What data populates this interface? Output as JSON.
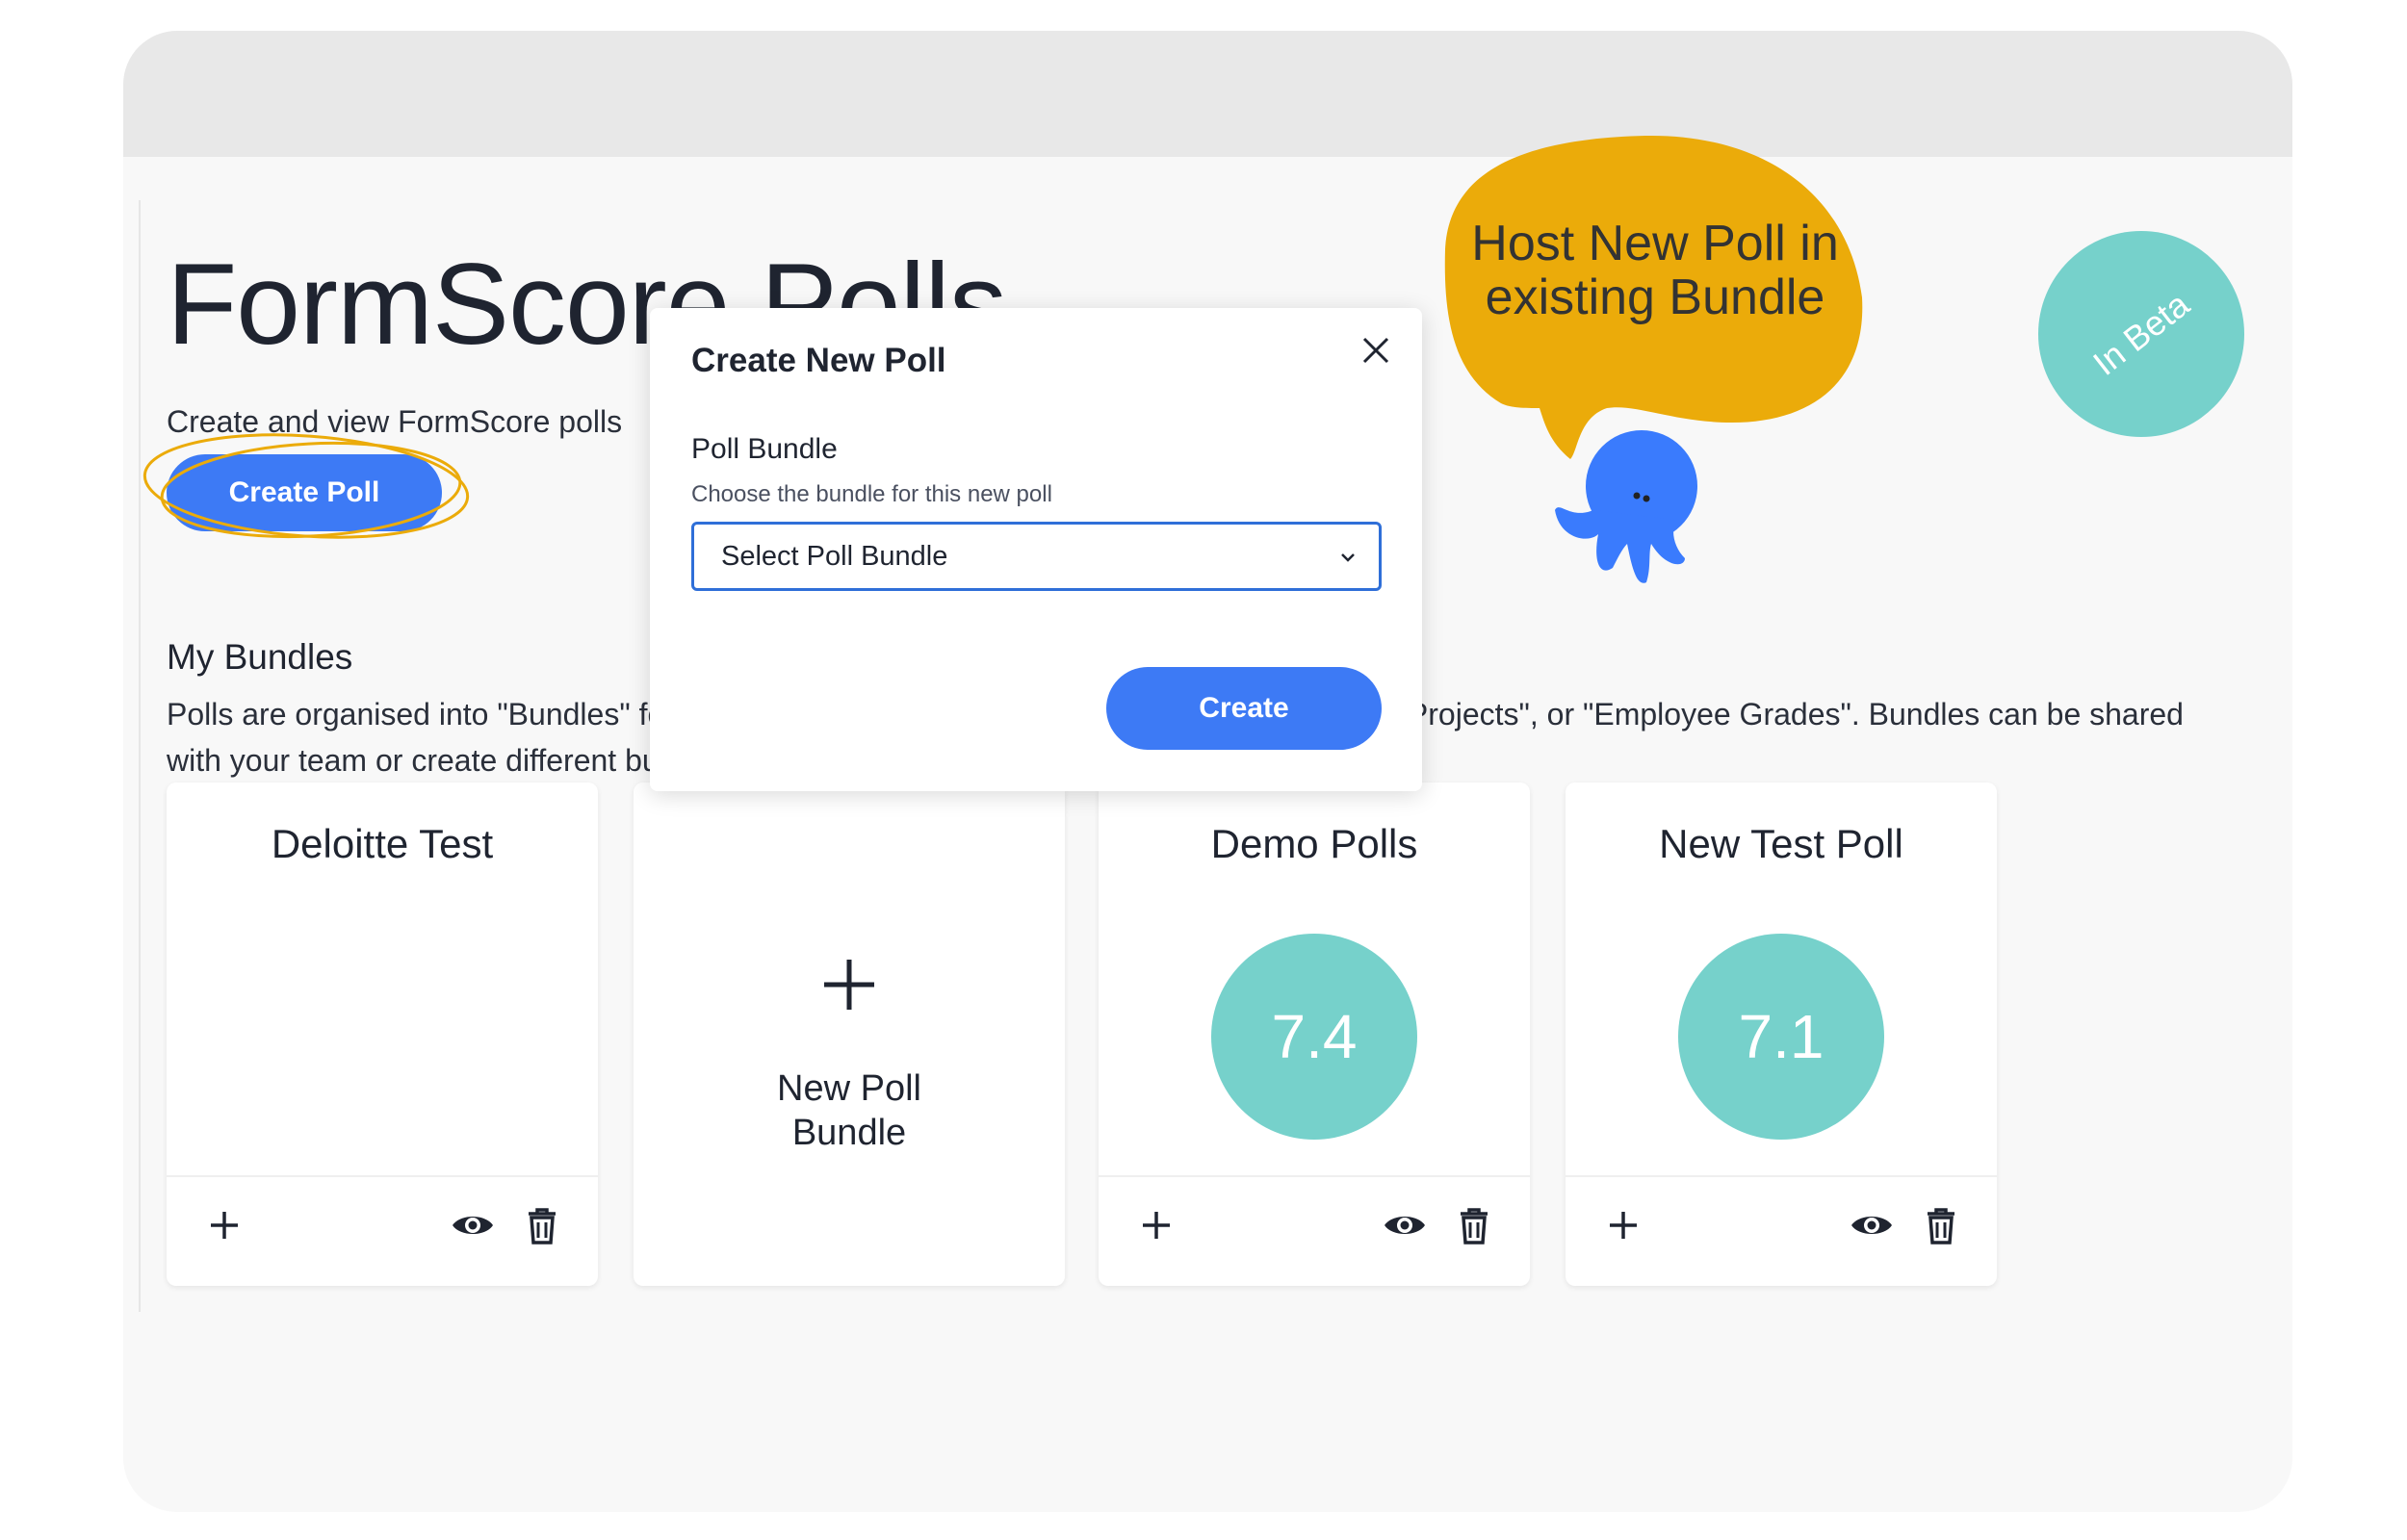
{
  "page": {
    "title": "FormScore Polls",
    "subtitle": "Create and view FormScore polls",
    "create_poll_label": "Create Poll"
  },
  "bundles": {
    "heading": "My Bundles",
    "description": "Polls are organised into \"Bundles\" for different scenarios and groups eg \"Team Meetings\", \"Projects\", or \"Employee Grades\". Bundles can be shared with your team or create different bundles as you see fit.",
    "cards": [
      {
        "title": "Deloitte Test"
      },
      {
        "title": "New Poll Bundle"
      },
      {
        "title": "Demo Polls",
        "score": "7.4"
      },
      {
        "title": "New Test Poll",
        "score": "7.1"
      }
    ]
  },
  "callout": {
    "text": "Host New Poll in existing Bundle",
    "color": "#ebab0a"
  },
  "beta_badge": "In Beta",
  "modal": {
    "title": "Create New Poll",
    "field_label": "Poll Bundle",
    "field_help": "Choose the bundle for this new poll",
    "select_placeholder": "Select Poll Bundle",
    "create_label": "Create"
  },
  "colors": {
    "primary": "#3d7af5",
    "score": "#76d1cb"
  }
}
